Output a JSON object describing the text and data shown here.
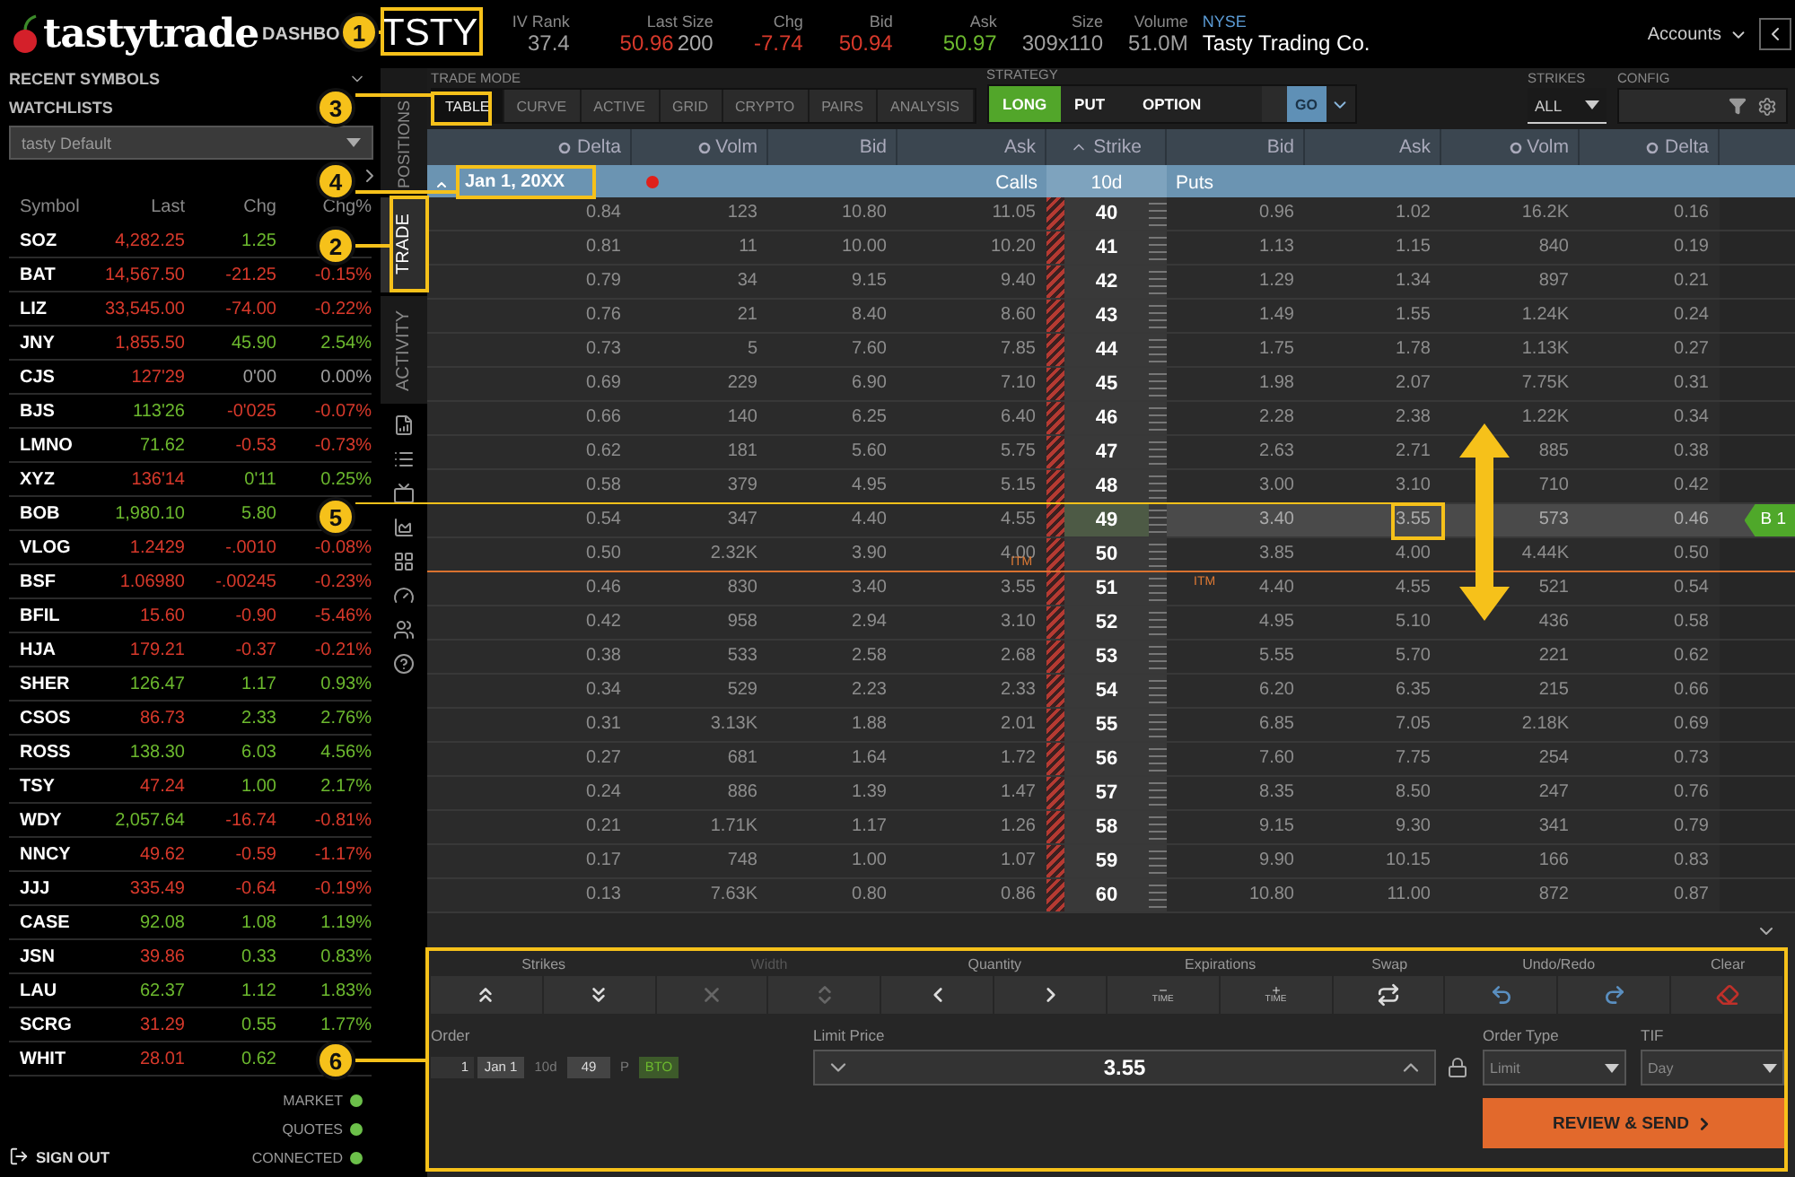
{
  "logo": "tastytrade",
  "nav": "DASHBO",
  "symbol": "TSTY",
  "quote": [
    {
      "label": "IV Rank",
      "value": "37.4",
      "color": "#a0a0a0"
    },
    {
      "label": "Last Size",
      "value": "50.96",
      "color": "#d8392b",
      "extra": "200"
    },
    {
      "label": "Chg",
      "value": "-7.74",
      "color": "#d8392b"
    },
    {
      "label": "Bid",
      "value": "50.94",
      "color": "#d8392b"
    },
    {
      "label": "Ask",
      "value": "50.97",
      "color": "#6cb92e"
    },
    {
      "label": "Size",
      "value": "309x110",
      "color": "#a0a0a0"
    },
    {
      "label": "Volume",
      "value": "51.0M",
      "color": "#a0a0a0"
    }
  ],
  "exchange": "NYSE",
  "company": "Tasty Trading Co.",
  "accounts": "Accounts",
  "sidebar": {
    "recent_symbols": "RECENT SYMBOLS",
    "watchlists_label": "WATCHLISTS",
    "watchlist_select": "tasty Default",
    "columns": [
      "Symbol",
      "Last",
      "Chg",
      "Chg%"
    ],
    "rows": [
      {
        "symbol": "SOZ",
        "last": {
          "text": "4,282.25",
          "color": "#d8392b"
        },
        "chg": {
          "text": "1.25",
          "color": "#6cb92e"
        }
      },
      {
        "symbol": "BAT",
        "last": {
          "text": "14,567.50",
          "color": "#d8392b"
        },
        "chg": {
          "text": "-21.25",
          "color": "#d8392b"
        },
        "pct": {
          "text": "-0.15%",
          "color": "#d8392b"
        }
      },
      {
        "symbol": "LIZ",
        "last": {
          "text": "33,545.00",
          "color": "#d8392b"
        },
        "chg": {
          "text": "-74.00",
          "color": "#d8392b"
        },
        "pct": {
          "text": "-0.22%",
          "color": "#d8392b"
        }
      },
      {
        "symbol": "JNY",
        "last": {
          "text": "1,855.50",
          "color": "#d8392b"
        },
        "chg": {
          "text": "45.90",
          "color": "#6cb92e"
        },
        "pct": {
          "text": "2.54%",
          "color": "#6cb92e"
        }
      },
      {
        "symbol": "CJS",
        "last": {
          "text": "127'29",
          "color": "#d8392b"
        },
        "chg": {
          "text": "0'00",
          "color": "#a0a0a0"
        },
        "pct": {
          "text": "0.00%",
          "color": "#a0a0a0"
        }
      },
      {
        "symbol": "BJS",
        "last": {
          "text": "113'26",
          "color": "#6cb92e"
        },
        "chg": {
          "text": "-0'025",
          "color": "#d8392b"
        },
        "pct": {
          "text": "-0.07%",
          "color": "#d8392b"
        }
      },
      {
        "symbol": "LMNO",
        "last": {
          "text": "71.62",
          "color": "#6cb92e"
        },
        "chg": {
          "text": "-0.53",
          "color": "#d8392b"
        },
        "pct": {
          "text": "-0.73%",
          "color": "#d8392b"
        }
      },
      {
        "symbol": "XYZ",
        "last": {
          "text": "136'14",
          "color": "#d8392b"
        },
        "chg": {
          "text": "0'11",
          "color": "#6cb92e"
        },
        "pct": {
          "text": "0.25%",
          "color": "#6cb92e"
        }
      },
      {
        "symbol": "BOB",
        "last": {
          "text": "1,980.10",
          "color": "#6cb92e"
        },
        "chg": {
          "text": "5.80",
          "color": "#6cb92e"
        }
      },
      {
        "symbol": "VLOG",
        "last": {
          "text": "1.2429",
          "color": "#d8392b"
        },
        "chg": {
          "text": "-.0010",
          "color": "#d8392b"
        },
        "pct": {
          "text": "-0.08%",
          "color": "#d8392b"
        }
      },
      {
        "symbol": "BSF",
        "last": {
          "text": "1.06980",
          "color": "#d8392b"
        },
        "chg": {
          "text": "-.00245",
          "color": "#d8392b"
        },
        "pct": {
          "text": "-0.23%",
          "color": "#d8392b"
        }
      },
      {
        "symbol": "BFIL",
        "last": {
          "text": "15.60",
          "color": "#d8392b"
        },
        "chg": {
          "text": "-0.90",
          "color": "#d8392b"
        },
        "pct": {
          "text": "-5.46%",
          "color": "#d8392b"
        }
      },
      {
        "symbol": "HJA",
        "last": {
          "text": "179.21",
          "color": "#d8392b"
        },
        "chg": {
          "text": "-0.37",
          "color": "#d8392b"
        },
        "pct": {
          "text": "-0.21%",
          "color": "#d8392b"
        }
      },
      {
        "symbol": "SHER",
        "last": {
          "text": "126.47",
          "color": "#6cb92e"
        },
        "chg": {
          "text": "1.17",
          "color": "#6cb92e"
        },
        "pct": {
          "text": "0.93%",
          "color": "#6cb92e"
        }
      },
      {
        "symbol": "CSOS",
        "last": {
          "text": "86.73",
          "color": "#d8392b"
        },
        "chg": {
          "text": "2.33",
          "color": "#6cb92e"
        },
        "pct": {
          "text": "2.76%",
          "color": "#6cb92e"
        }
      },
      {
        "symbol": "ROSS",
        "last": {
          "text": "138.30",
          "color": "#6cb92e"
        },
        "chg": {
          "text": "6.03",
          "color": "#6cb92e"
        },
        "pct": {
          "text": "4.56%",
          "color": "#6cb92e"
        }
      },
      {
        "symbol": "TSY",
        "last": {
          "text": "47.24",
          "color": "#d8392b"
        },
        "chg": {
          "text": "1.00",
          "color": "#6cb92e"
        },
        "pct": {
          "text": "2.17%",
          "color": "#6cb92e"
        }
      },
      {
        "symbol": "WDY",
        "last": {
          "text": "2,057.64",
          "color": "#6cb92e"
        },
        "chg": {
          "text": "-16.74",
          "color": "#d8392b"
        },
        "pct": {
          "text": "-0.81%",
          "color": "#d8392b"
        }
      },
      {
        "symbol": "NNCY",
        "last": {
          "text": "49.62",
          "color": "#d8392b"
        },
        "chg": {
          "text": "-0.59",
          "color": "#d8392b"
        },
        "pct": {
          "text": "-1.17%",
          "color": "#d8392b"
        }
      },
      {
        "symbol": "JJJ",
        "last": {
          "text": "335.49",
          "color": "#d8392b"
        },
        "chg": {
          "text": "-0.64",
          "color": "#d8392b"
        },
        "pct": {
          "text": "-0.19%",
          "color": "#d8392b"
        }
      },
      {
        "symbol": "CASE",
        "last": {
          "text": "92.08",
          "color": "#6cb92e"
        },
        "chg": {
          "text": "1.08",
          "color": "#6cb92e"
        },
        "pct": {
          "text": "1.19%",
          "color": "#6cb92e"
        }
      },
      {
        "symbol": "JSN",
        "last": {
          "text": "39.86",
          "color": "#d8392b"
        },
        "chg": {
          "text": "0.33",
          "color": "#6cb92e"
        },
        "pct": {
          "text": "0.83%",
          "color": "#6cb92e"
        }
      },
      {
        "symbol": "LAU",
        "last": {
          "text": "62.37",
          "color": "#6cb92e"
        },
        "chg": {
          "text": "1.12",
          "color": "#6cb92e"
        },
        "pct": {
          "text": "1.83%",
          "color": "#6cb92e"
        }
      },
      {
        "symbol": "SCRG",
        "last": {
          "text": "31.29",
          "color": "#d8392b"
        },
        "chg": {
          "text": "0.55",
          "color": "#6cb92e"
        },
        "pct": {
          "text": "1.77%",
          "color": "#6cb92e"
        }
      },
      {
        "symbol": "WHIT",
        "last": {
          "text": "28.01",
          "color": "#d8392b"
        },
        "chg": {
          "text": "0.62",
          "color": "#6cb92e"
        }
      }
    ],
    "status": [
      {
        "label": "MARKET",
        "on": true
      },
      {
        "label": "QUOTES",
        "on": true
      },
      {
        "label": "CONNECTED",
        "on": true
      }
    ],
    "sign_out": "SIGN OUT"
  },
  "side_tabs": [
    {
      "label": "POSITIONS",
      "selected": false
    },
    {
      "label": "TRADE",
      "selected": true
    },
    {
      "label": "ACTIVITY",
      "selected": false
    }
  ],
  "toolbar": {
    "trade_mode_label": "TRADE MODE",
    "trade_modes": [
      {
        "label": "TABLE",
        "selected": true
      },
      {
        "label": "CURVE",
        "selected": false
      },
      {
        "label": "ACTIVE",
        "selected": false
      },
      {
        "label": "GRID",
        "selected": false
      },
      {
        "label": "CRYPTO",
        "selected": false
      },
      {
        "label": "PAIRS",
        "selected": false
      },
      {
        "label": "ANALYSIS",
        "selected": false
      }
    ],
    "strategy_label": "STRATEGY",
    "strategy": [
      {
        "label": "LONG",
        "selected": true
      },
      {
        "label": "PUT",
        "selected": false
      },
      {
        "label": "OPTION",
        "selected": false
      }
    ],
    "go": "GO",
    "strikes_label": "STRIKES",
    "strikes": "ALL",
    "config_label": "CONFIG"
  },
  "chain": {
    "columns": [
      "Delta",
      "Volm",
      "Bid",
      "Ask",
      "Strike",
      "Bid",
      "Ask",
      "Volm",
      "Delta"
    ],
    "expiration": {
      "date": "Jan 1, 20XX",
      "calls": "Calls",
      "days": "10d",
      "puts": "Puts"
    },
    "itm_labels": [
      "ITM",
      "ITM"
    ],
    "rows": [
      {
        "strike": "40",
        "calls": [
          "0.84",
          "123",
          "10.80",
          "11.05"
        ],
        "puts": [
          "0.96",
          "1.02",
          "16.2K",
          "0.16"
        ],
        "selected": false,
        "price_line": false
      },
      {
        "strike": "41",
        "calls": [
          "0.81",
          "11",
          "10.00",
          "10.20"
        ],
        "puts": [
          "1.13",
          "1.15",
          "840",
          "0.19"
        ],
        "selected": false,
        "price_line": false
      },
      {
        "strike": "42",
        "calls": [
          "0.79",
          "34",
          "9.15",
          "9.40"
        ],
        "puts": [
          "1.29",
          "1.34",
          "897",
          "0.21"
        ],
        "selected": false,
        "price_line": false
      },
      {
        "strike": "43",
        "calls": [
          "0.76",
          "21",
          "8.40",
          "8.60"
        ],
        "puts": [
          "1.49",
          "1.55",
          "1.24K",
          "0.24"
        ],
        "selected": false,
        "price_line": false
      },
      {
        "strike": "44",
        "calls": [
          "0.73",
          "5",
          "7.60",
          "7.85"
        ],
        "puts": [
          "1.75",
          "1.78",
          "1.13K",
          "0.27"
        ],
        "selected": false,
        "price_line": false
      },
      {
        "strike": "45",
        "calls": [
          "0.69",
          "229",
          "6.90",
          "7.10"
        ],
        "puts": [
          "1.98",
          "2.07",
          "7.75K",
          "0.31"
        ],
        "selected": false,
        "price_line": false
      },
      {
        "strike": "46",
        "calls": [
          "0.66",
          "140",
          "6.25",
          "6.40"
        ],
        "puts": [
          "2.28",
          "2.38",
          "1.22K",
          "0.34"
        ],
        "selected": false,
        "price_line": false
      },
      {
        "strike": "47",
        "calls": [
          "0.62",
          "181",
          "5.60",
          "5.75"
        ],
        "puts": [
          "2.63",
          "2.71",
          "885",
          "0.38"
        ],
        "selected": false,
        "price_line": false
      },
      {
        "strike": "48",
        "calls": [
          "0.58",
          "379",
          "4.95",
          "5.15"
        ],
        "puts": [
          "3.00",
          "3.10",
          "710",
          "0.42"
        ],
        "selected": false,
        "price_line": false
      },
      {
        "strike": "49",
        "calls": [
          "0.54",
          "347",
          "4.40",
          "4.55"
        ],
        "puts": [
          "3.40",
          "3.55",
          "573",
          "0.46"
        ],
        "selected": true,
        "price_line": false,
        "tag": "B 1"
      },
      {
        "strike": "50",
        "calls": [
          "0.50",
          "2.32K",
          "3.90",
          "4.00"
        ],
        "puts": [
          "3.85",
          "4.00",
          "4.44K",
          "0.50"
        ],
        "selected": false,
        "price_line": true
      },
      {
        "strike": "51",
        "calls": [
          "0.46",
          "830",
          "3.40",
          "3.55"
        ],
        "puts": [
          "4.40",
          "4.55",
          "521",
          "0.54"
        ],
        "selected": false,
        "price_line": false
      },
      {
        "strike": "52",
        "calls": [
          "0.42",
          "958",
          "2.94",
          "3.10"
        ],
        "puts": [
          "4.95",
          "5.10",
          "436",
          "0.58"
        ],
        "selected": false,
        "price_line": false
      },
      {
        "strike": "53",
        "calls": [
          "0.38",
          "533",
          "2.58",
          "2.68"
        ],
        "puts": [
          "5.55",
          "5.70",
          "221",
          "0.62"
        ],
        "selected": false,
        "price_line": false
      },
      {
        "strike": "54",
        "calls": [
          "0.34",
          "529",
          "2.23",
          "2.33"
        ],
        "puts": [
          "6.20",
          "6.35",
          "215",
          "0.66"
        ],
        "selected": false,
        "price_line": false
      },
      {
        "strike": "55",
        "calls": [
          "0.31",
          "3.13K",
          "1.88",
          "2.01"
        ],
        "puts": [
          "6.85",
          "7.05",
          "2.18K",
          "0.69"
        ],
        "selected": false,
        "price_line": false
      },
      {
        "strike": "56",
        "calls": [
          "0.27",
          "681",
          "1.64",
          "1.72"
        ],
        "puts": [
          "7.60",
          "7.75",
          "254",
          "0.73"
        ],
        "selected": false,
        "price_line": false
      },
      {
        "strike": "57",
        "calls": [
          "0.24",
          "886",
          "1.39",
          "1.47"
        ],
        "puts": [
          "8.35",
          "8.50",
          "247",
          "0.76"
        ],
        "selected": false,
        "price_line": false
      },
      {
        "strike": "58",
        "calls": [
          "0.21",
          "1.71K",
          "1.17",
          "1.26"
        ],
        "puts": [
          "9.15",
          "9.30",
          "341",
          "0.79"
        ],
        "selected": false,
        "price_line": false
      },
      {
        "strike": "59",
        "calls": [
          "0.17",
          "748",
          "1.00",
          "1.07"
        ],
        "puts": [
          "9.90",
          "10.15",
          "166",
          "0.83"
        ],
        "selected": false,
        "price_line": false
      },
      {
        "strike": "60",
        "calls": [
          "0.13",
          "7.63K",
          "0.80",
          "0.86"
        ],
        "puts": [
          "10.80",
          "11.00",
          "872",
          "0.87"
        ],
        "selected": false,
        "price_line": false
      }
    ]
  },
  "order": {
    "groups": [
      {
        "label": "Strikes",
        "kind": "strikes",
        "disabled": false
      },
      {
        "label": "Width",
        "kind": "width",
        "disabled": true
      },
      {
        "label": "Quantity",
        "kind": "quantity",
        "disabled": false
      },
      {
        "label": "Expirations",
        "kind": "expirations",
        "disabled": false
      },
      {
        "label": "Swap",
        "kind": "swap",
        "disabled": false
      },
      {
        "label": "Undo/Redo",
        "kind": "undo",
        "disabled": false
      },
      {
        "label": "Clear",
        "kind": "clear",
        "disabled": false
      }
    ],
    "time_labels": [
      "TIME",
      "TIME"
    ],
    "order_label": "Order",
    "legs": [
      {
        "text": "1",
        "kind": "qty"
      },
      {
        "text": "Jan 1",
        "kind": "exp"
      },
      {
        "text": "10d",
        "kind": "dte"
      },
      {
        "text": "49",
        "kind": "strike"
      },
      {
        "text": "P",
        "kind": "type"
      },
      {
        "text": "BTO",
        "kind": "action"
      }
    ],
    "limit_label": "Limit Price",
    "limit": "3.55",
    "order_type_label": "Order Type",
    "order_type": "Limit",
    "tif_label": "TIF",
    "tif": "Day",
    "submit": "REVIEW & SEND"
  },
  "callouts": [
    "1",
    "3",
    "4",
    "2",
    "5",
    "6"
  ]
}
